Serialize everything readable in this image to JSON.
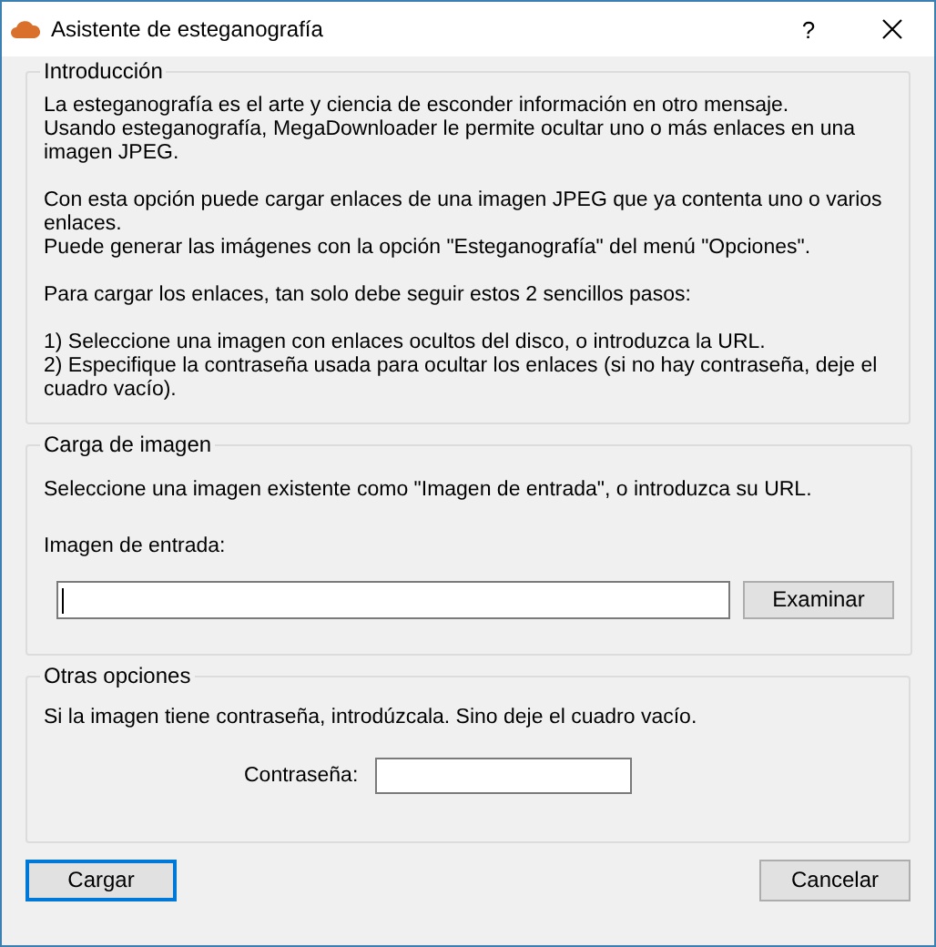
{
  "window": {
    "title": "Asistente de esteganografía",
    "help": "?"
  },
  "intro": {
    "title": "Introducción",
    "paragraphs": [
      [
        "La esteganografía es el arte y ciencia de esconder información en otro mensaje.",
        "Usando esteganografía, MegaDownloader le permite ocultar uno o más enlaces en una imagen JPEG."
      ],
      [
        "Con esta opción puede cargar enlaces de una imagen JPEG que ya contenta uno o varios enlaces.",
        "Puede generar las imágenes con la opción \"Esteganografía\" del menú \"Opciones\"."
      ],
      [
        "Para cargar los enlaces, tan solo debe seguir estos 2 sencillos pasos:"
      ],
      [
        "1) Seleccione una imagen con enlaces ocultos del disco, o introduzca la URL.",
        "2) Especifique la contraseña usada para ocultar los enlaces (si no hay contraseña, deje el cuadro vacío)."
      ]
    ]
  },
  "image_load": {
    "title": "Carga de imagen",
    "description": "Seleccione una imagen existente como \"Imagen de entrada\", o introduzca su URL.",
    "field_label": "Imagen de entrada:",
    "field_focused": true,
    "browse_button": "Examinar"
  },
  "other_options": {
    "title": "Otras opciones",
    "description": "Si la imagen tiene contraseña, introdúzcala. Sino deje el cuadro vacío.",
    "password_label": "Contraseña:"
  },
  "buttons": [
    {
      "label": "Cargar",
      "default": true
    },
    {
      "label": "Cancelar",
      "default": false
    }
  ]
}
